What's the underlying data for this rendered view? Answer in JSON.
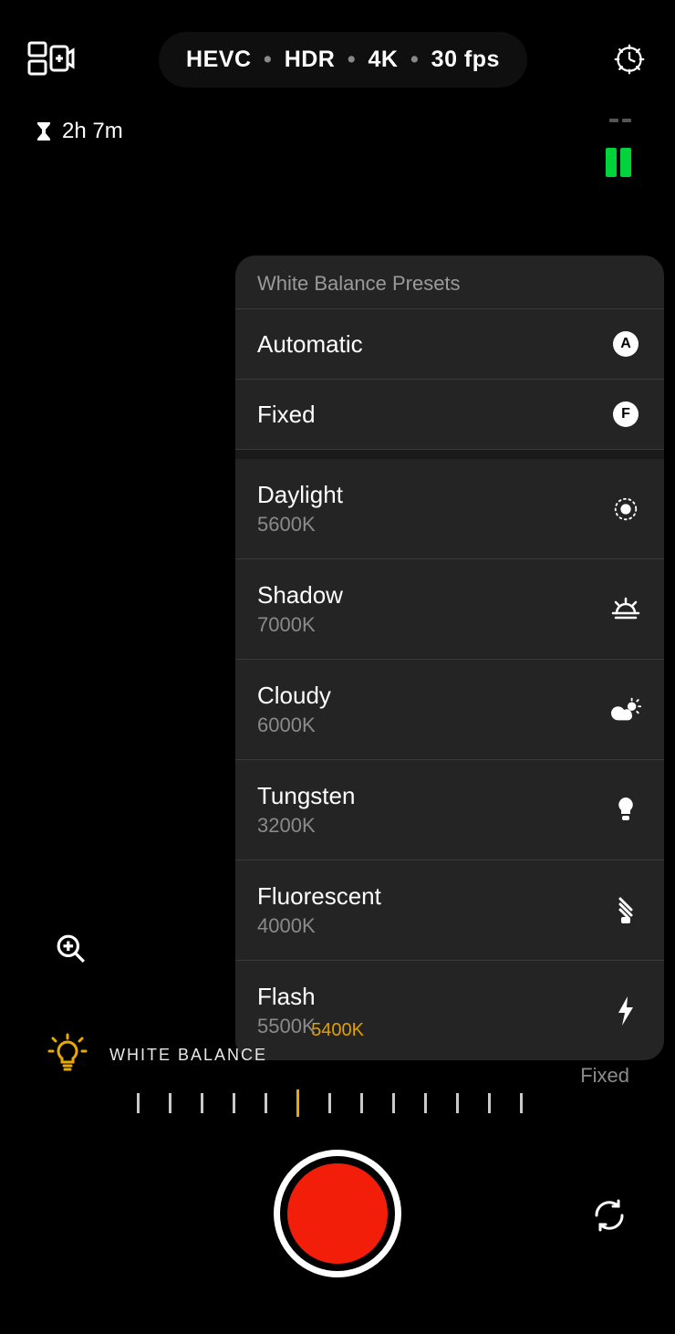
{
  "topbar": {
    "format_codec": "HEVC",
    "format_hdr": "HDR",
    "format_res": "4K",
    "format_fps": "30 fps"
  },
  "status": {
    "time_remaining": "2h 7m"
  },
  "panel": {
    "header": "White Balance Presets",
    "simple": [
      {
        "label": "Automatic",
        "badge": "A"
      },
      {
        "label": "Fixed",
        "badge": "F"
      }
    ],
    "presets": [
      {
        "label": "Daylight",
        "kelvin": "5600K",
        "icon": "sun"
      },
      {
        "label": "Shadow",
        "kelvin": "7000K",
        "icon": "sunset"
      },
      {
        "label": "Cloudy",
        "kelvin": "6000K",
        "icon": "cloud-sun"
      },
      {
        "label": "Tungsten",
        "kelvin": "3200K",
        "icon": "bulb"
      },
      {
        "label": "Fluorescent",
        "kelvin": "4000K",
        "icon": "cfl"
      },
      {
        "label": "Flash",
        "kelvin": "5500K",
        "icon": "bolt"
      }
    ]
  },
  "wb": {
    "label": "WHITE BALANCE",
    "value": "5400K",
    "mode": "Fixed"
  },
  "colors": {
    "accent": "#e8aa00",
    "record": "#f31e0a",
    "meter": "#00d43a"
  }
}
